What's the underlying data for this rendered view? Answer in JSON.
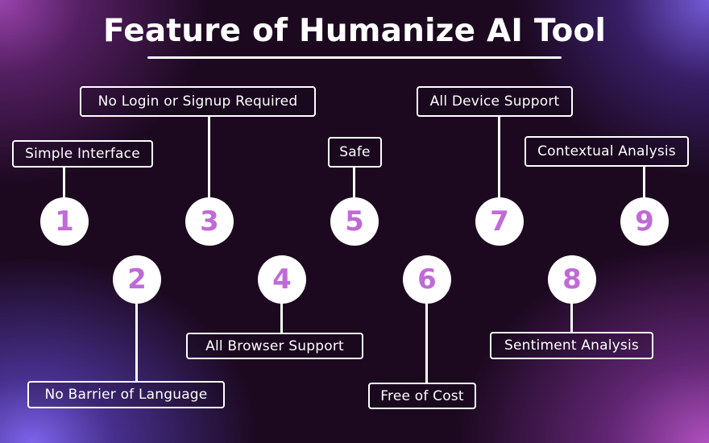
{
  "header": {
    "title": "Feature of Humanize AI Tool"
  },
  "colors": {
    "number_color": "#c06ad8",
    "background": "#1c0920",
    "accent_purple": "#a046b4",
    "accent_violet": "#7d64eb"
  },
  "features": [
    {
      "number": "1",
      "label": "Simple Interface"
    },
    {
      "number": "2",
      "label": "No Barrier of Language"
    },
    {
      "number": "3",
      "label": "No Login or Signup Required"
    },
    {
      "number": "4",
      "label": "All Browser Support"
    },
    {
      "number": "5",
      "label": "Safe"
    },
    {
      "number": "6",
      "label": "Free of Cost"
    },
    {
      "number": "7",
      "label": "All Device Support"
    },
    {
      "number": "8",
      "label": "Sentiment Analysis"
    },
    {
      "number": "9",
      "label": "Contextual Analysis"
    }
  ]
}
